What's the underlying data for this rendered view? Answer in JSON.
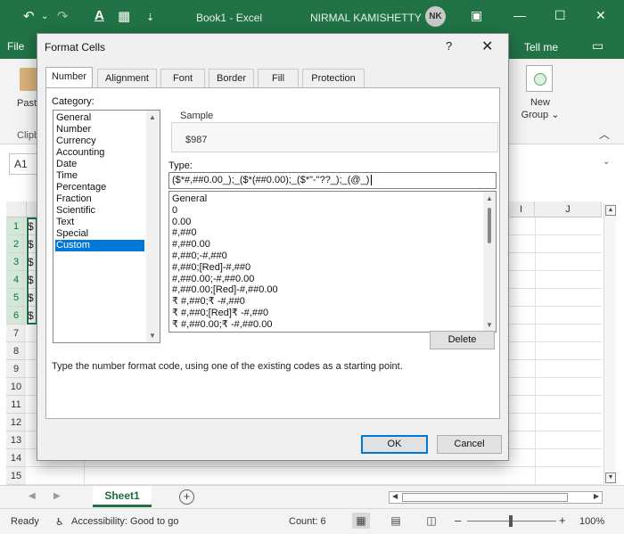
{
  "excel": {
    "quick_access": {
      "undo": "↶",
      "undo_drop": "⌄",
      "redo": "↷",
      "format": "A",
      "borders": "▦",
      "customize": "⇣"
    },
    "window_title": "Book1  -  Excel",
    "user_name": "NIRMAL KAMISHETTY",
    "user_initials": "NK",
    "file_tab": "File",
    "tell_me": "Tell me",
    "ribbon": {
      "paste": "Paste",
      "clipboard": "Clipbo",
      "new_group": "New Group ⌄"
    },
    "name_box": "A1",
    "columns": [
      "I",
      "J"
    ],
    "rows": [
      "1",
      "2",
      "3",
      "4",
      "5",
      "6",
      "7",
      "8",
      "9",
      "10",
      "11",
      "12",
      "13",
      "14",
      "15"
    ],
    "col_a_values": [
      "$",
      "$",
      "$",
      "$",
      "$",
      "$"
    ],
    "sheet_tab": "Sheet1",
    "status": {
      "ready": "Ready",
      "accessibility": "Accessibility: Good to go",
      "count": "Count: 6",
      "zoom": "100%"
    }
  },
  "dialog": {
    "title": "Format Cells",
    "help": "?",
    "close": "✕",
    "tabs": [
      "Number",
      "Alignment",
      "Font",
      "Border",
      "Fill",
      "Protection"
    ],
    "active_tab": "Number",
    "category_label": "Category:",
    "categories": [
      "General",
      "Number",
      "Currency",
      "Accounting",
      "Date",
      "Time",
      "Percentage",
      "Fraction",
      "Scientific",
      "Text",
      "Special",
      "Custom"
    ],
    "selected_category": "Custom",
    "sample_label": "Sample",
    "sample_value": "$987",
    "type_label": "Type:",
    "type_value": "($*#,##0.00_);_($*(##0.00);_($*\"-\"??_);_(@_)",
    "type_list": [
      "General",
      "0",
      "0.00",
      "#,##0",
      "#,##0.00",
      "#,##0;-#,##0",
      "#,##0;[Red]-#,##0",
      "#,##0.00;-#,##0.00",
      "#,##0.00;[Red]-#,##0.00",
      "₹ #,##0;₹ -#,##0",
      "₹ #,##0;[Red]₹ -#,##0",
      "₹ #,##0.00;₹ -#,##0.00"
    ],
    "delete_button": "Delete",
    "hint": "Type the number format code, using one of the existing codes as a starting point.",
    "ok_button": "OK",
    "cancel_button": "Cancel"
  }
}
